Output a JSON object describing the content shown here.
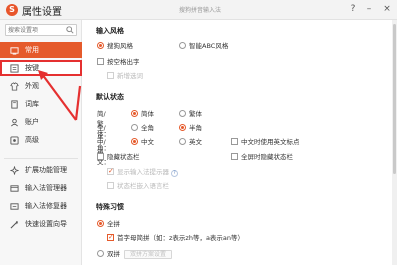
{
  "window": {
    "logo_text": "S",
    "title": "属性设置",
    "center_title": "搜狗拼音输入法",
    "help_label": "?",
    "minimize_label": "–",
    "close_label": "×"
  },
  "sidebar": {
    "search_placeholder": "搜索设置项",
    "items": [
      {
        "label": "常用",
        "icon": "home-icon",
        "state": "active"
      },
      {
        "label": "按键",
        "icon": "keyboard-icon",
        "state": "highlighted"
      },
      {
        "label": "外观",
        "icon": "shirt-icon",
        "state": "normal"
      },
      {
        "label": "词库",
        "icon": "book-icon",
        "state": "normal"
      },
      {
        "label": "账户",
        "icon": "user-icon",
        "state": "normal"
      },
      {
        "label": "高级",
        "icon": "advanced-icon",
        "state": "normal"
      }
    ],
    "tools": [
      {
        "label": "扩展功能管理",
        "icon": "extension-icon"
      },
      {
        "label": "输入法管理器",
        "icon": "ime-manager-icon"
      },
      {
        "label": "输入法修复器",
        "icon": "ime-repair-icon"
      },
      {
        "label": "快速设置向导",
        "icon": "wizard-icon"
      }
    ]
  },
  "input_style": {
    "title": "输入风格",
    "sogou_style": "搜狗风格",
    "abc_style": "智能ABC风格",
    "candidate_output": "按空格出字",
    "new_words": "新增选词"
  },
  "default_state": {
    "title": "默认状态",
    "trad_simp_label": "简/繁体：",
    "simplified": "简体",
    "traditional": "繁体",
    "full_half_label": "全/半角：",
    "full_width": "全角",
    "half_width": "半角",
    "cn_en_label": "中/英文：",
    "chinese": "中文",
    "english": "英文",
    "english_punct": "中文时使用英文标点",
    "hide_status_bar": "隐藏状态栏",
    "fullscreen_hide": "全屏时隐藏状态栏",
    "show_indicator": "显示输入法提示器",
    "embed_status": "状态栏嵌入语言栏"
  },
  "special_habits": {
    "title": "特殊习惯",
    "full_pinyin": "全拼",
    "initial_abbrev": "首字母简拼（如：z表示zh等，a表示an等）",
    "double_pinyin": "双拼",
    "double_pinyin_settings": "双拼方案设置"
  },
  "colors": {
    "accent": "#e55a2b",
    "annotation": "#e53030"
  }
}
